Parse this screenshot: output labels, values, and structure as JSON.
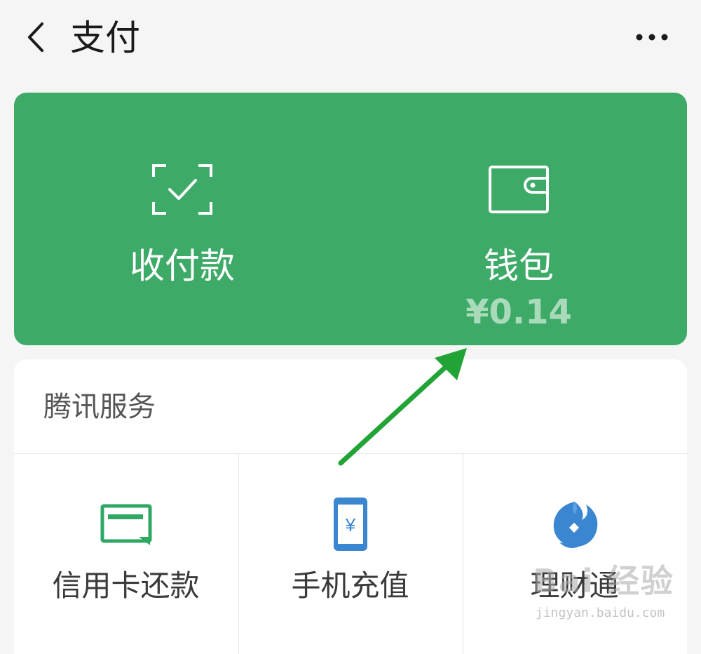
{
  "header": {
    "title": "支付",
    "back_icon": "chevron-left-icon",
    "more_icon": "more-horizontal-icon"
  },
  "card": {
    "background_color": "#3eaa68",
    "pay": {
      "label": "收付款",
      "icon": "scan-check-icon"
    },
    "wallet": {
      "label": "钱包",
      "icon": "wallet-icon",
      "balance": "¥0.14"
    }
  },
  "services": {
    "header": "腾讯服务",
    "items": [
      {
        "label": "信用卡还款",
        "icon": "credit-card-icon",
        "color": "#2ea863"
      },
      {
        "label": "手机充值",
        "icon": "phone-recharge-icon",
        "color": "#3a86d1"
      },
      {
        "label": "理财通",
        "icon": "licaitong-icon",
        "color": "#3a86d1"
      }
    ]
  },
  "annotation": {
    "arrow_color": "#22a336"
  },
  "watermark": {
    "text": "Bai 经验",
    "subtext": "jingyan.baidu.com"
  }
}
